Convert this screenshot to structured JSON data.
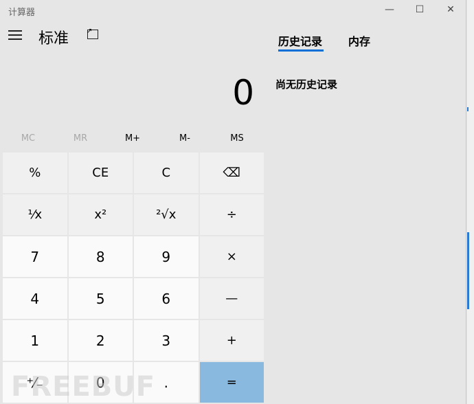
{
  "window": {
    "title": "计算器",
    "minimize": "—",
    "maximize": "☐",
    "close": "✕"
  },
  "header": {
    "mode": "标准"
  },
  "tabs": [
    {
      "label": "历史记录",
      "active": true
    },
    {
      "label": "内存",
      "active": false
    }
  ],
  "history": {
    "empty_text": "尚无历史记录"
  },
  "display": {
    "value": "0"
  },
  "memory": [
    {
      "label": "MC",
      "enabled": false
    },
    {
      "label": "MR",
      "enabled": false
    },
    {
      "label": "M+",
      "enabled": true
    },
    {
      "label": "M-",
      "enabled": true
    },
    {
      "label": "MS",
      "enabled": true
    }
  ],
  "keys": [
    {
      "label": "%",
      "name": "percent"
    },
    {
      "label": "CE",
      "name": "clear-entry"
    },
    {
      "label": "C",
      "name": "clear"
    },
    {
      "label": "⌫",
      "name": "backspace"
    },
    {
      "label": "¹⁄x",
      "name": "reciprocal"
    },
    {
      "label": "x²",
      "name": "square"
    },
    {
      "label": "²√x",
      "name": "square-root"
    },
    {
      "label": "÷",
      "name": "divide"
    },
    {
      "label": "7",
      "name": "digit-7"
    },
    {
      "label": "8",
      "name": "digit-8"
    },
    {
      "label": "9",
      "name": "digit-9"
    },
    {
      "label": "×",
      "name": "multiply"
    },
    {
      "label": "4",
      "name": "digit-4"
    },
    {
      "label": "5",
      "name": "digit-5"
    },
    {
      "label": "6",
      "name": "digit-6"
    },
    {
      "label": "—",
      "name": "subtract"
    },
    {
      "label": "1",
      "name": "digit-1"
    },
    {
      "label": "2",
      "name": "digit-2"
    },
    {
      "label": "3",
      "name": "digit-3"
    },
    {
      "label": "+",
      "name": "add"
    },
    {
      "label": "⁺⁄₋",
      "name": "negate"
    },
    {
      "label": "0",
      "name": "digit-0"
    },
    {
      "label": ".",
      "name": "decimal"
    },
    {
      "label": "=",
      "name": "equals"
    }
  ],
  "watermark": "FREEBUF",
  "colors": {
    "accent": "#0a6fd6",
    "equals": "#8ab9e0"
  }
}
